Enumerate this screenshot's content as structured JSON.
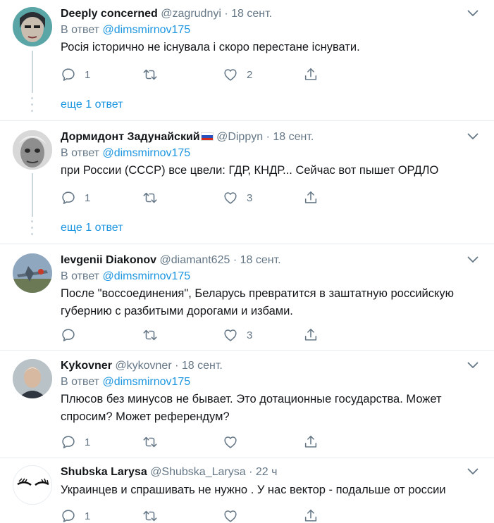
{
  "labels": {
    "reply_prefix": "В ответ",
    "dot": "·",
    "more_replies": "еще 1 ответ"
  },
  "colors": {
    "link": "#1b95e0",
    "secondary": "#657786",
    "text": "#14171a",
    "divider": "#e6ecf0"
  },
  "tweets": [
    {
      "name": "Deeply concerned",
      "handle": "@zagrudnyi",
      "time": "18 сент.",
      "reply_to": "@dimsmirnov175",
      "text": "Росія історично не існувала і скоро перестане існувати.",
      "replies": "1",
      "retweets": "",
      "likes": "2"
    },
    {
      "name": "Дормидонт Задунайский",
      "flag_icon": "russia-flag-icon",
      "handle": "@Dippyn",
      "time": "18 сент.",
      "reply_to": "@dimsmirnov175",
      "text": "при России (СССР) все цвели: ГДР, КНДР... Сейчас вот пышет ОРДЛО",
      "replies": "1",
      "retweets": "",
      "likes": "3"
    },
    {
      "name": "Ievgenii Diakonov",
      "handle": "@diamant625",
      "time": "18 сент.",
      "reply_to": "@dimsmirnov175",
      "text": "После \"воссоединения\", Беларусь превратится в заштатную российскую губернию с разбитыми дорогами и избами.",
      "replies": "",
      "retweets": "",
      "likes": "3"
    },
    {
      "name": "Kykovner",
      "handle": "@kykovner",
      "time": "18 сент.",
      "reply_to": "@dimsmirnov175",
      "text": "Плюсов без минусов не бывает. Это дотационные государства. Может спросим? Может референдум?",
      "replies": "1",
      "retweets": "",
      "likes": ""
    },
    {
      "name": "Shubska Larysa",
      "handle": "@Shubska_Larysa",
      "time": "22 ч",
      "reply_to": "",
      "text": "Украинцев и спрашивать не нужно . У нас вектор - подальше от россии",
      "replies": "1",
      "retweets": "",
      "likes": ""
    }
  ]
}
